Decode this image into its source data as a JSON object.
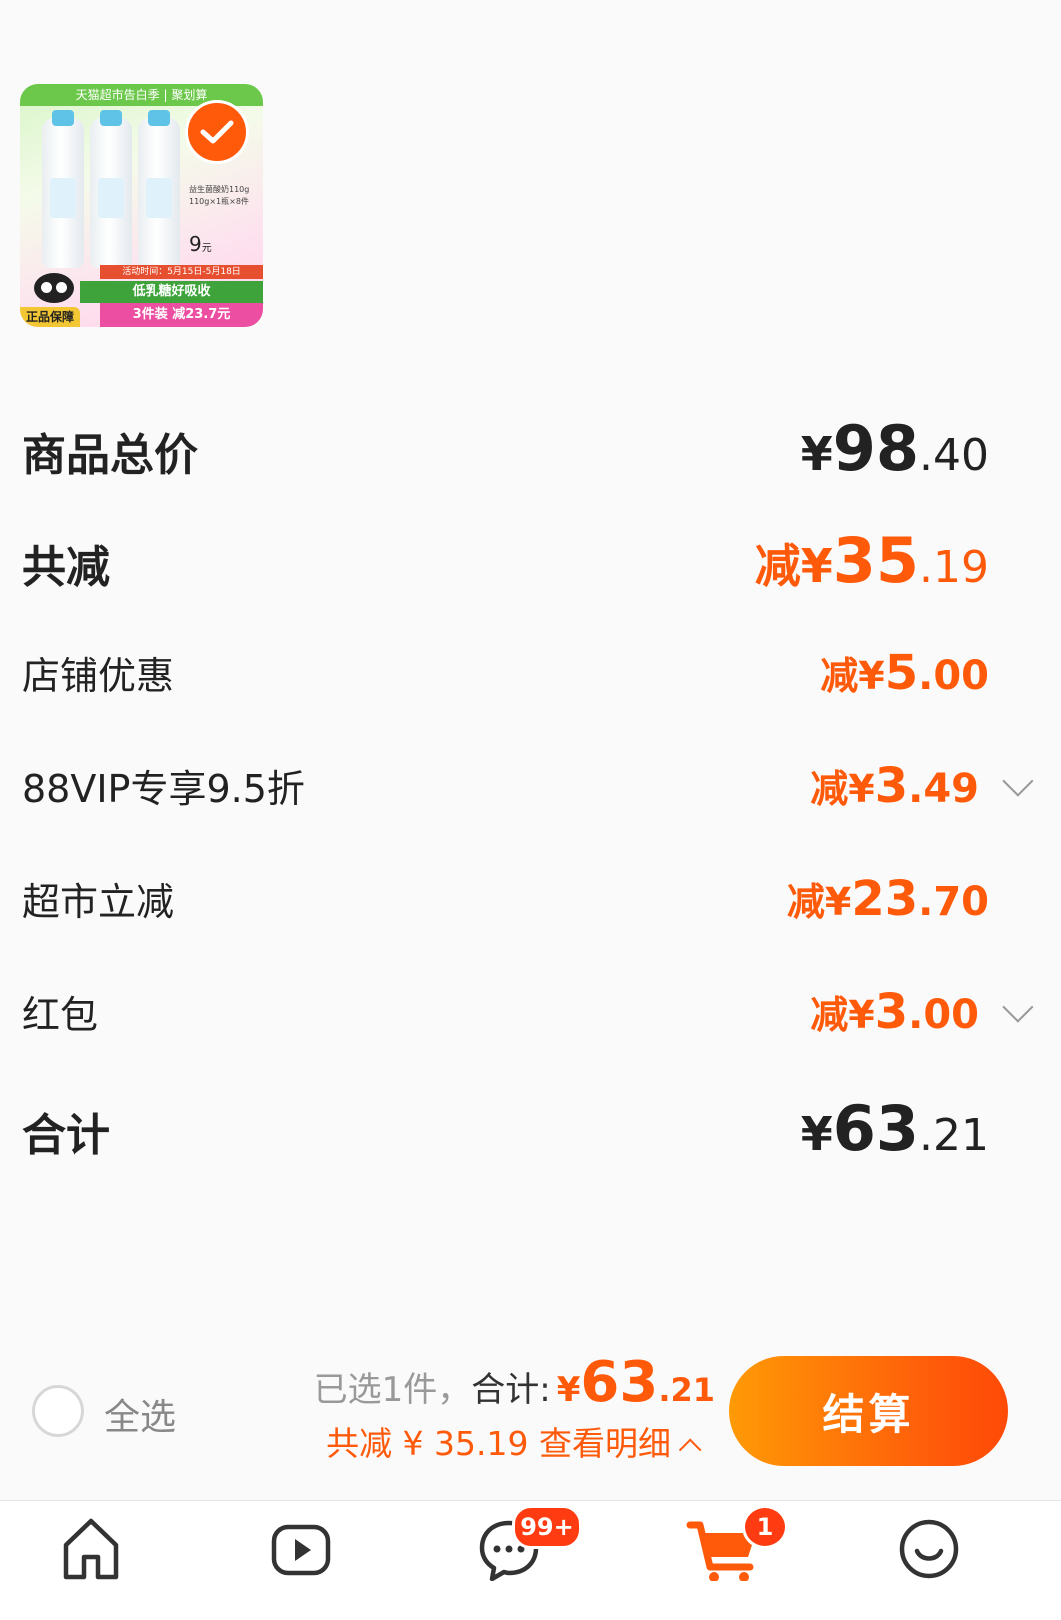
{
  "product": {
    "image_banner": "天猫超市告白季 | 聚划算",
    "image_side_info": "益生菌酸奶110g 110g×1瓶×8件",
    "image_side_price": "9",
    "image_side_price_unit": "元",
    "image_tag_guarantee": "正品保障",
    "image_strip_date": "活动时间：5月15日-5月18日",
    "image_strip_green": "低乳糖好吸收",
    "image_strip_pink": "3件装 减23.7元",
    "selected": true
  },
  "price_breakdown": {
    "items_total": {
      "label": "商品总价",
      "currency": "¥",
      "integer": "98",
      "decimal": ".40"
    },
    "total_discount": {
      "label": "共减",
      "prefix": "减¥",
      "integer": "35",
      "decimal": ".19"
    },
    "store_discount": {
      "label": "店铺优惠",
      "prefix": "减¥",
      "integer": "5",
      "decimal": ".00"
    },
    "vip_discount": {
      "label": "88VIP专享9.5折",
      "prefix": "减¥",
      "integer": "3",
      "decimal": ".49"
    },
    "market_discount": {
      "label": "超市立减",
      "prefix": "减¥",
      "integer": "23",
      "decimal": ".70"
    },
    "red_packet": {
      "label": "红包",
      "prefix": "减¥",
      "integer": "3",
      "decimal": ".00"
    },
    "grand_total": {
      "label": "合计",
      "currency": "¥",
      "integer": "63",
      "decimal": ".21"
    }
  },
  "action_bar": {
    "select_all_label": "全选",
    "selected_count_text": "已选1件，",
    "total_label": "合计:",
    "total_currency": "¥",
    "total_integer": "63",
    "total_decimal": ".21",
    "discount_summary": "共减 ¥ 35.19  查看明细",
    "checkout_label": "结算"
  },
  "tabbar": {
    "messages_badge": "99+",
    "cart_badge": "1",
    "icons": [
      "home-icon",
      "video-icon",
      "messages-icon",
      "cart-icon",
      "profile-icon"
    ]
  },
  "colors": {
    "accent": "#ff5a0a",
    "background": "#fafafa"
  }
}
